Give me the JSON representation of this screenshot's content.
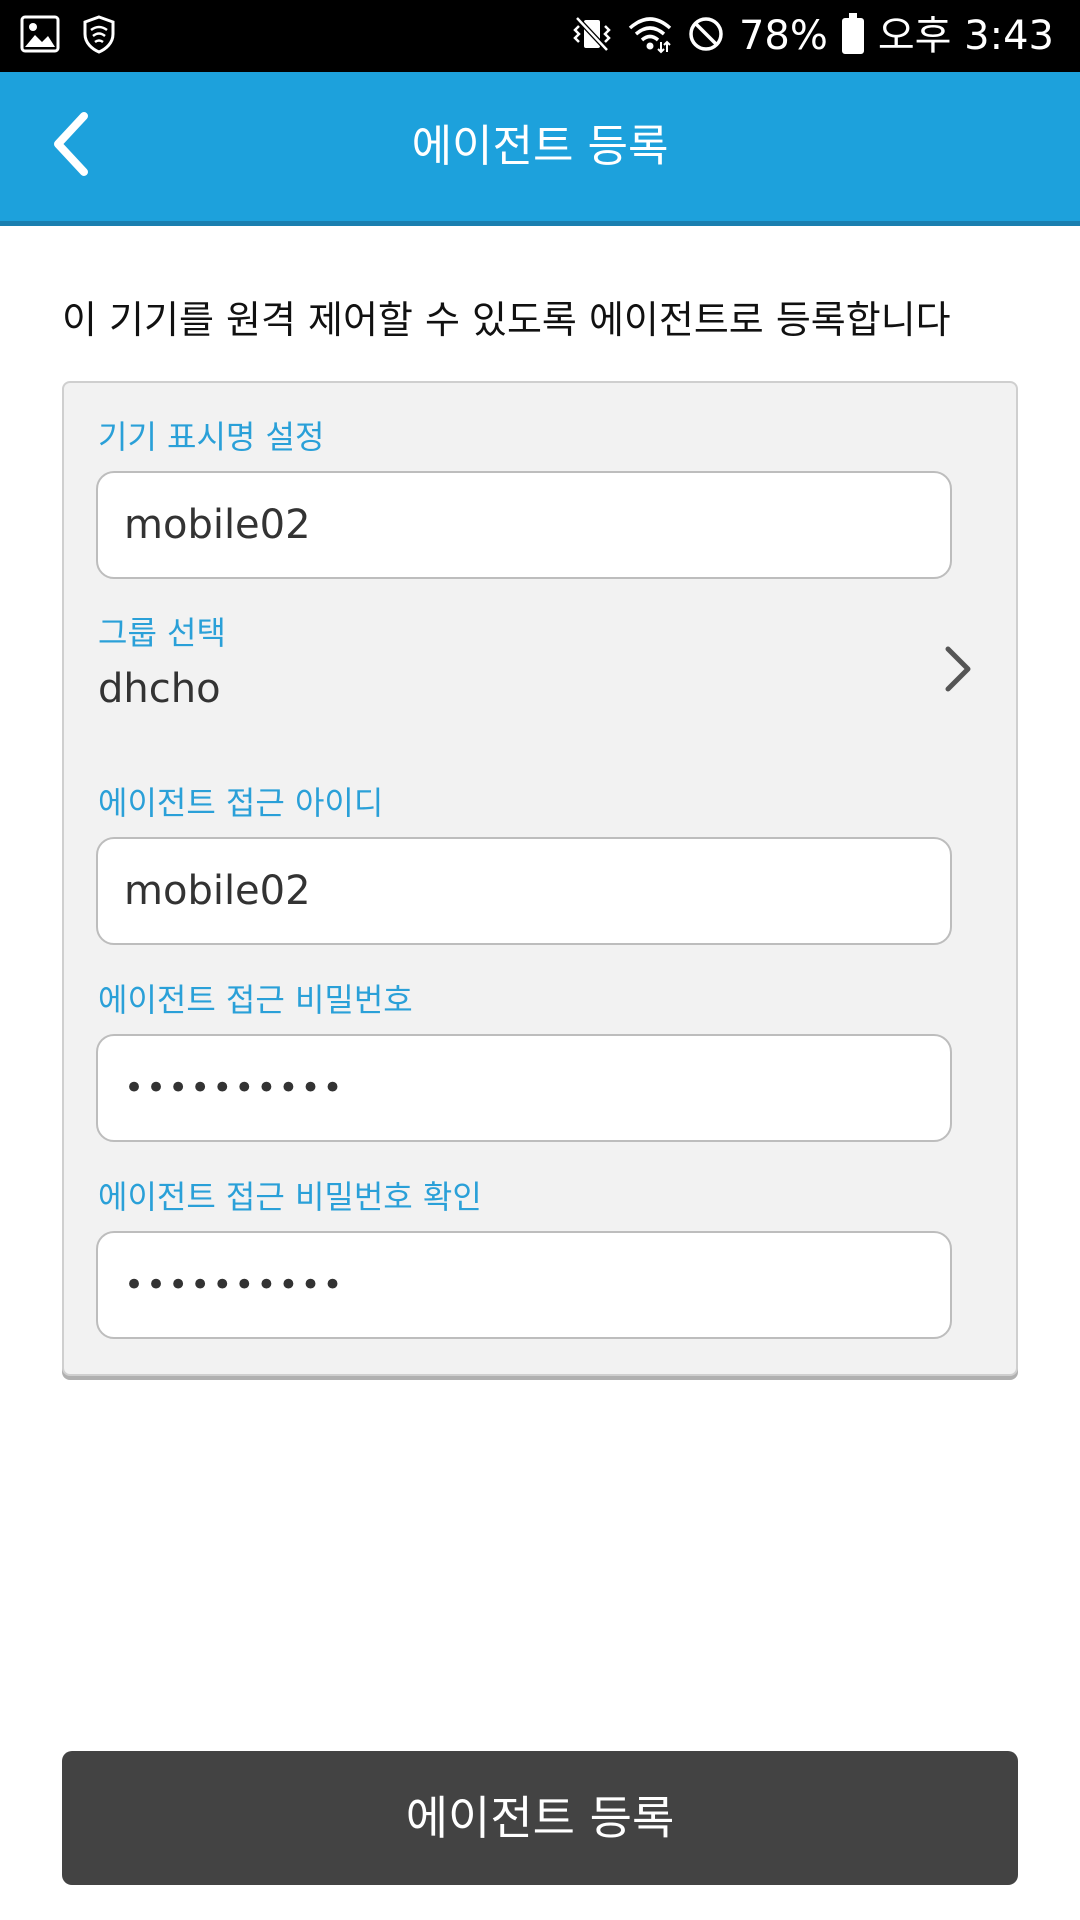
{
  "status_bar": {
    "battery_percent": "78%",
    "time": "오후 3:43",
    "icons": [
      "gallery-icon",
      "shield-icon",
      "vibrate-mute-icon",
      "wifi-icon",
      "do-not-disturb-icon",
      "battery-icon"
    ]
  },
  "appbar": {
    "title": "에이전트 등록",
    "back_icon": "chevron-left-icon"
  },
  "intro_text": "이 기기를 원격 제어할 수 있도록 에이전트로 등록합니다",
  "form": {
    "display_name": {
      "label": "기기 표시명 설정",
      "value": "mobile02"
    },
    "group": {
      "label": "그룹 선택",
      "value": "dhcho",
      "icon": "chevron-right-icon"
    },
    "access_id": {
      "label": "에이전트 접근 아이디",
      "value": "mobile02"
    },
    "password": {
      "label": "에이전트 접근 비밀번호",
      "value": "••••••••••"
    },
    "password_confirm": {
      "label": "에이전트 접근 비밀번호 확인",
      "value": "••••••••••"
    }
  },
  "submit_button": {
    "label": "에이전트 등록"
  },
  "colors": {
    "appbar": "#1da1dc",
    "label": "#2aa0d8",
    "button": "#434343",
    "card": "#f2f2f2"
  }
}
